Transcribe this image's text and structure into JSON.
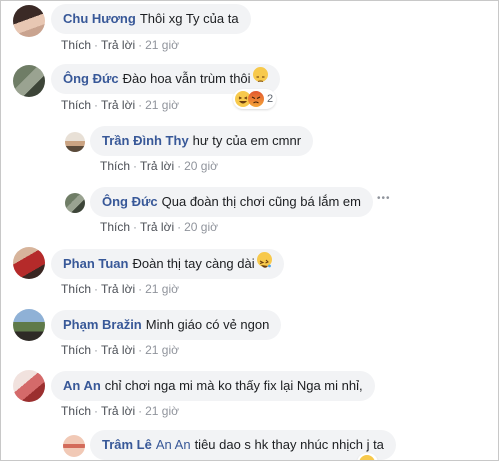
{
  "colors": {
    "author": "#385898",
    "bubble": "#f2f3f5",
    "meta": "#90949c"
  },
  "action_like": "Thích",
  "action_reply": "Trả lời",
  "comments": [
    {
      "author": "Chu Hương",
      "text": "Thôi xg Ty của ta",
      "time": "21 giờ"
    },
    {
      "author": "Ông Đức",
      "text": "Đào hoa vẫn trùm thôi",
      "time": "21 giờ",
      "emoji": "unamused-emoji-icon",
      "reaction_count": "2"
    },
    {
      "author": "Trần Đình Thy",
      "text": "hư ty của em cmnr",
      "time": "20 giờ"
    },
    {
      "author": "Ông Đức",
      "text": "Qua đoàn thị chơi cũng bá lắm em",
      "time": "20 giờ",
      "more": "•••"
    },
    {
      "author": "Phan Tuan",
      "text": "Đoàn thị tay càng dài",
      "time": "21 giờ",
      "emoji": "rofl-emoji-icon"
    },
    {
      "author": "Phạm Bražin",
      "text": "Minh giáo có vẻ ngon",
      "time": "21 giờ"
    },
    {
      "author": "An An",
      "text": "chỉ chơi nga mi mà ko thấy fix lại Nga mi nhỉ,",
      "time": "21 giờ"
    },
    {
      "author": "Trâm Lê",
      "tag": "An An",
      "text": "tiêu dao s hk thay nhúc nhịch j ta"
    }
  ]
}
